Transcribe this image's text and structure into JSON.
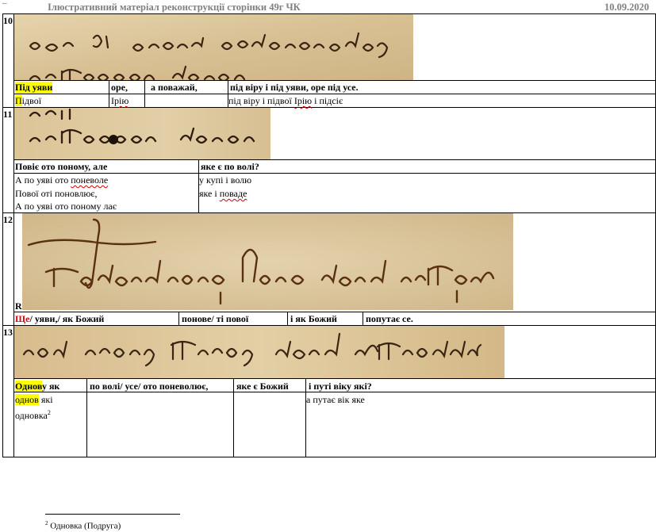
{
  "header": {
    "title": "Ілюстративний матеріал  реконструкції сторінки 49г ЧК",
    "date": "10.09.2020"
  },
  "sections": {
    "s10": {
      "number": "10",
      "h1": "Під уяви",
      "h2": "оре,",
      "h3": "а поважай,",
      "h4": "під віру і під уяви, оре під усе.",
      "r1_prefix": "П",
      "r1_rest": "ідвої",
      "r2": "Ірію",
      "r3": "",
      "r4_a": "під віру і підвої ",
      "r4_b": "Ірію",
      "r4_c": " і підсіє"
    },
    "s11": {
      "number": "11",
      "h1": "Повіє ото поному, але",
      "h2": "яке є по волі?",
      "l1_a": "А по уяві ото ",
      "l1_b": "поневоле",
      "l2": "Пової оті поновлює,",
      "l3": "А по уяві ото поному лає",
      "r1": "у купі і волю",
      "r2_a": "яке і ",
      "r2_b": "поваде"
    },
    "s12": {
      "number": "12",
      "marker": "R",
      "h1_a": "Ще",
      "h1_b": "/ уяви,/ як Божий",
      "h2": "понове/ ті пової",
      "h3": "і як Божий",
      "h4": "попутає се."
    },
    "s13": {
      "number": "13",
      "h1_a": "Однов",
      "h1_b": "у як",
      "h2": "по волі/ усе/ ото поневолює,",
      "h3": "яке є Божий",
      "h4": "і путі віку які?",
      "c1_a": "однов",
      "c1_b": " які",
      "c1_c": "одновка",
      "c1_sup": "2",
      "c4": "а путає вік яке"
    }
  },
  "footnote": {
    "marker": "2",
    "text": "Одновка (Подруга)"
  }
}
